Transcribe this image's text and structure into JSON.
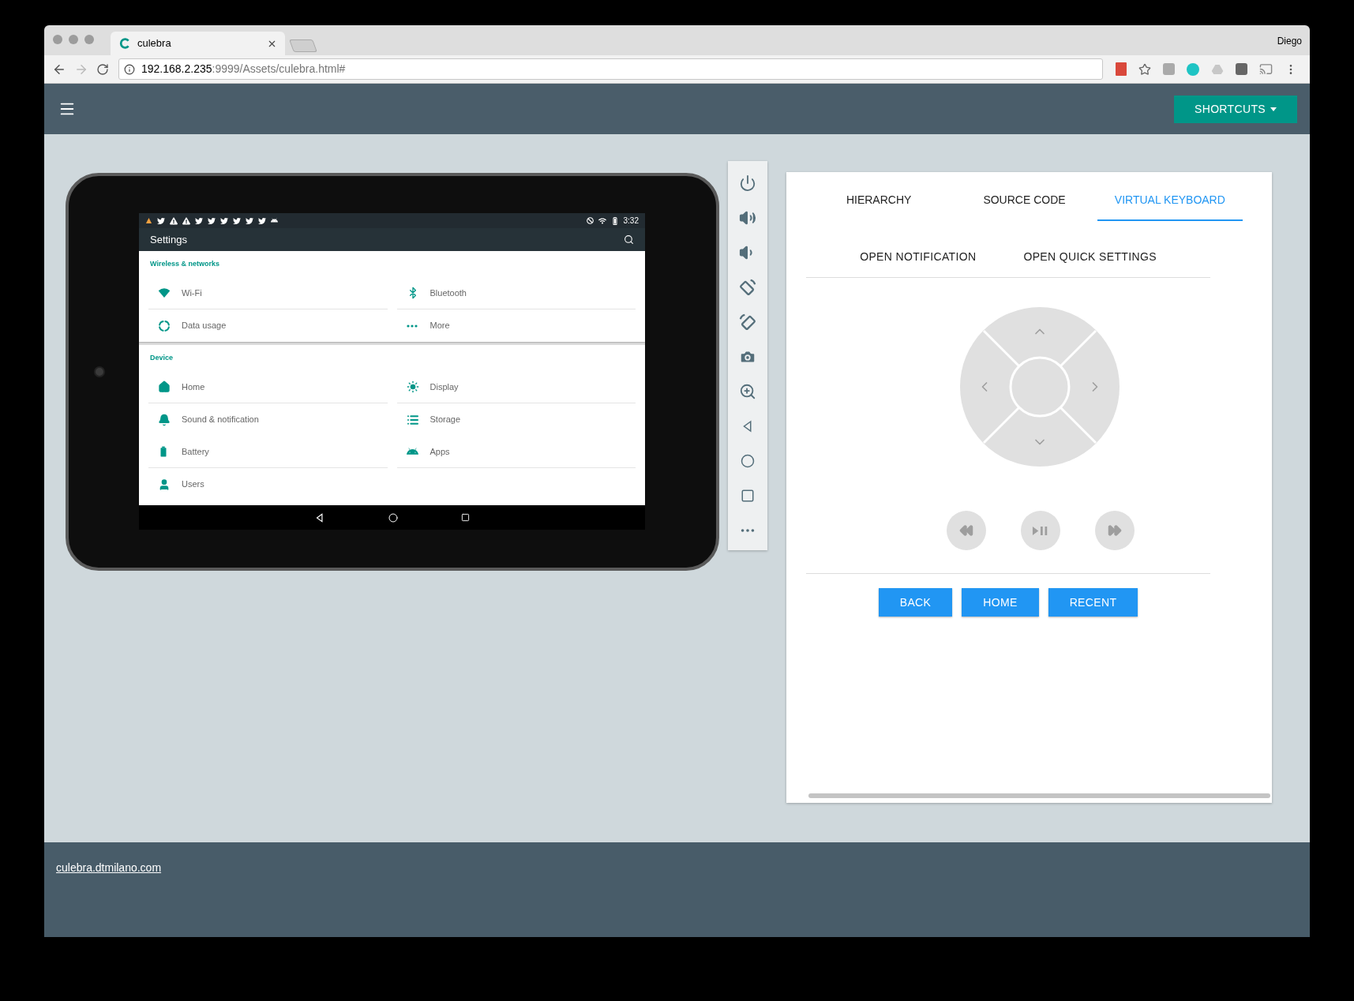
{
  "browser": {
    "tab_title": "culebra",
    "url_host": "192.168.2.235",
    "url_path": ":9999/Assets/culebra.html#",
    "profile": "Diego"
  },
  "header": {
    "shortcuts_button": "SHORTCUTS"
  },
  "device": {
    "status_time": "3:32",
    "app_title": "Settings",
    "sections": [
      {
        "title": "Wireless & networks",
        "items": [
          {
            "label": "Wi-Fi"
          },
          {
            "label": "Bluetooth"
          },
          {
            "label": "Data usage"
          },
          {
            "label": "More"
          }
        ]
      },
      {
        "title": "Device",
        "items": [
          {
            "label": "Home"
          },
          {
            "label": "Display"
          },
          {
            "label": "Sound & notification"
          },
          {
            "label": "Storage"
          },
          {
            "label": "Battery"
          },
          {
            "label": "Apps"
          },
          {
            "label": "Users"
          }
        ]
      }
    ]
  },
  "tabs": [
    {
      "label": "HIERARCHY",
      "selected": false
    },
    {
      "label": "SOURCE CODE",
      "selected": false
    },
    {
      "label": "VIRTUAL KEYBOARD",
      "selected": true
    }
  ],
  "actions": [
    "OPEN NOTIFICATION",
    "OPEN QUICK SETTINGS"
  ],
  "buttons": [
    "BACK",
    "HOME",
    "RECENT"
  ],
  "footer": {
    "link": "culebra.dtmilano.com"
  }
}
